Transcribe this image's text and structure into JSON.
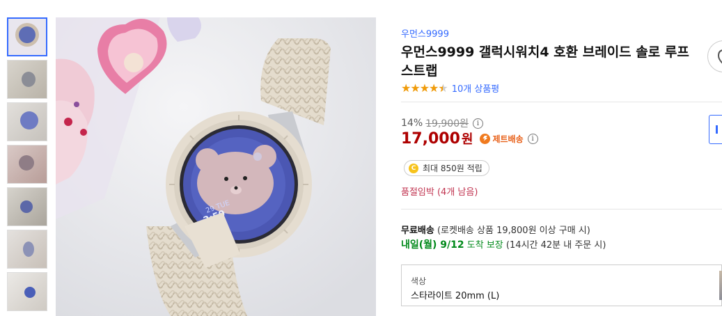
{
  "gallery": {
    "thumbnails": [
      {
        "alt": "thumb-1",
        "active": true
      },
      {
        "alt": "thumb-2",
        "active": false
      },
      {
        "alt": "thumb-3",
        "active": false
      },
      {
        "alt": "thumb-4",
        "active": false
      },
      {
        "alt": "thumb-5",
        "active": false
      },
      {
        "alt": "thumb-6",
        "active": false
      },
      {
        "alt": "thumb-7",
        "active": false
      }
    ],
    "watch_face": {
      "date": "29 TUE",
      "time": "2:59"
    }
  },
  "product": {
    "brand": "우먼스9999",
    "title": "우먼스9999 갤럭시워치4 호환 브레이드 솔로 루프 스트랩",
    "stars": "★★★★★",
    "rating": 4.5,
    "review_count": "10개 상품평",
    "discount_rate": "14%",
    "original_price": "19,900원",
    "price": "17,000",
    "currency": "원",
    "delivery_badge": "제트배송",
    "points_icon": "C",
    "points": "최대 850원 적립",
    "stock_notice": "품절임박 (4개 남음)"
  },
  "shipping": {
    "free_label": "무료배송",
    "free_detail": "(로켓배송 상품 19,800원 이상 구매 시)",
    "arrival_date": "내일(월) 9/12",
    "arrival_label": "도착 보장",
    "arrival_detail": "(14시간 42분 내 주문 시)"
  },
  "option": {
    "label": "색상",
    "value": "스타라이트 20mm (L)"
  },
  "icons": {
    "info": "i",
    "share": "share-icon",
    "jet": "jet-delivery-icon"
  },
  "colors": {
    "accent": "#346aff",
    "price": "#ae0000",
    "stock": "#c0334f",
    "arrival": "#00891a",
    "star": "#f09b0a",
    "jet": "#e8611a"
  }
}
